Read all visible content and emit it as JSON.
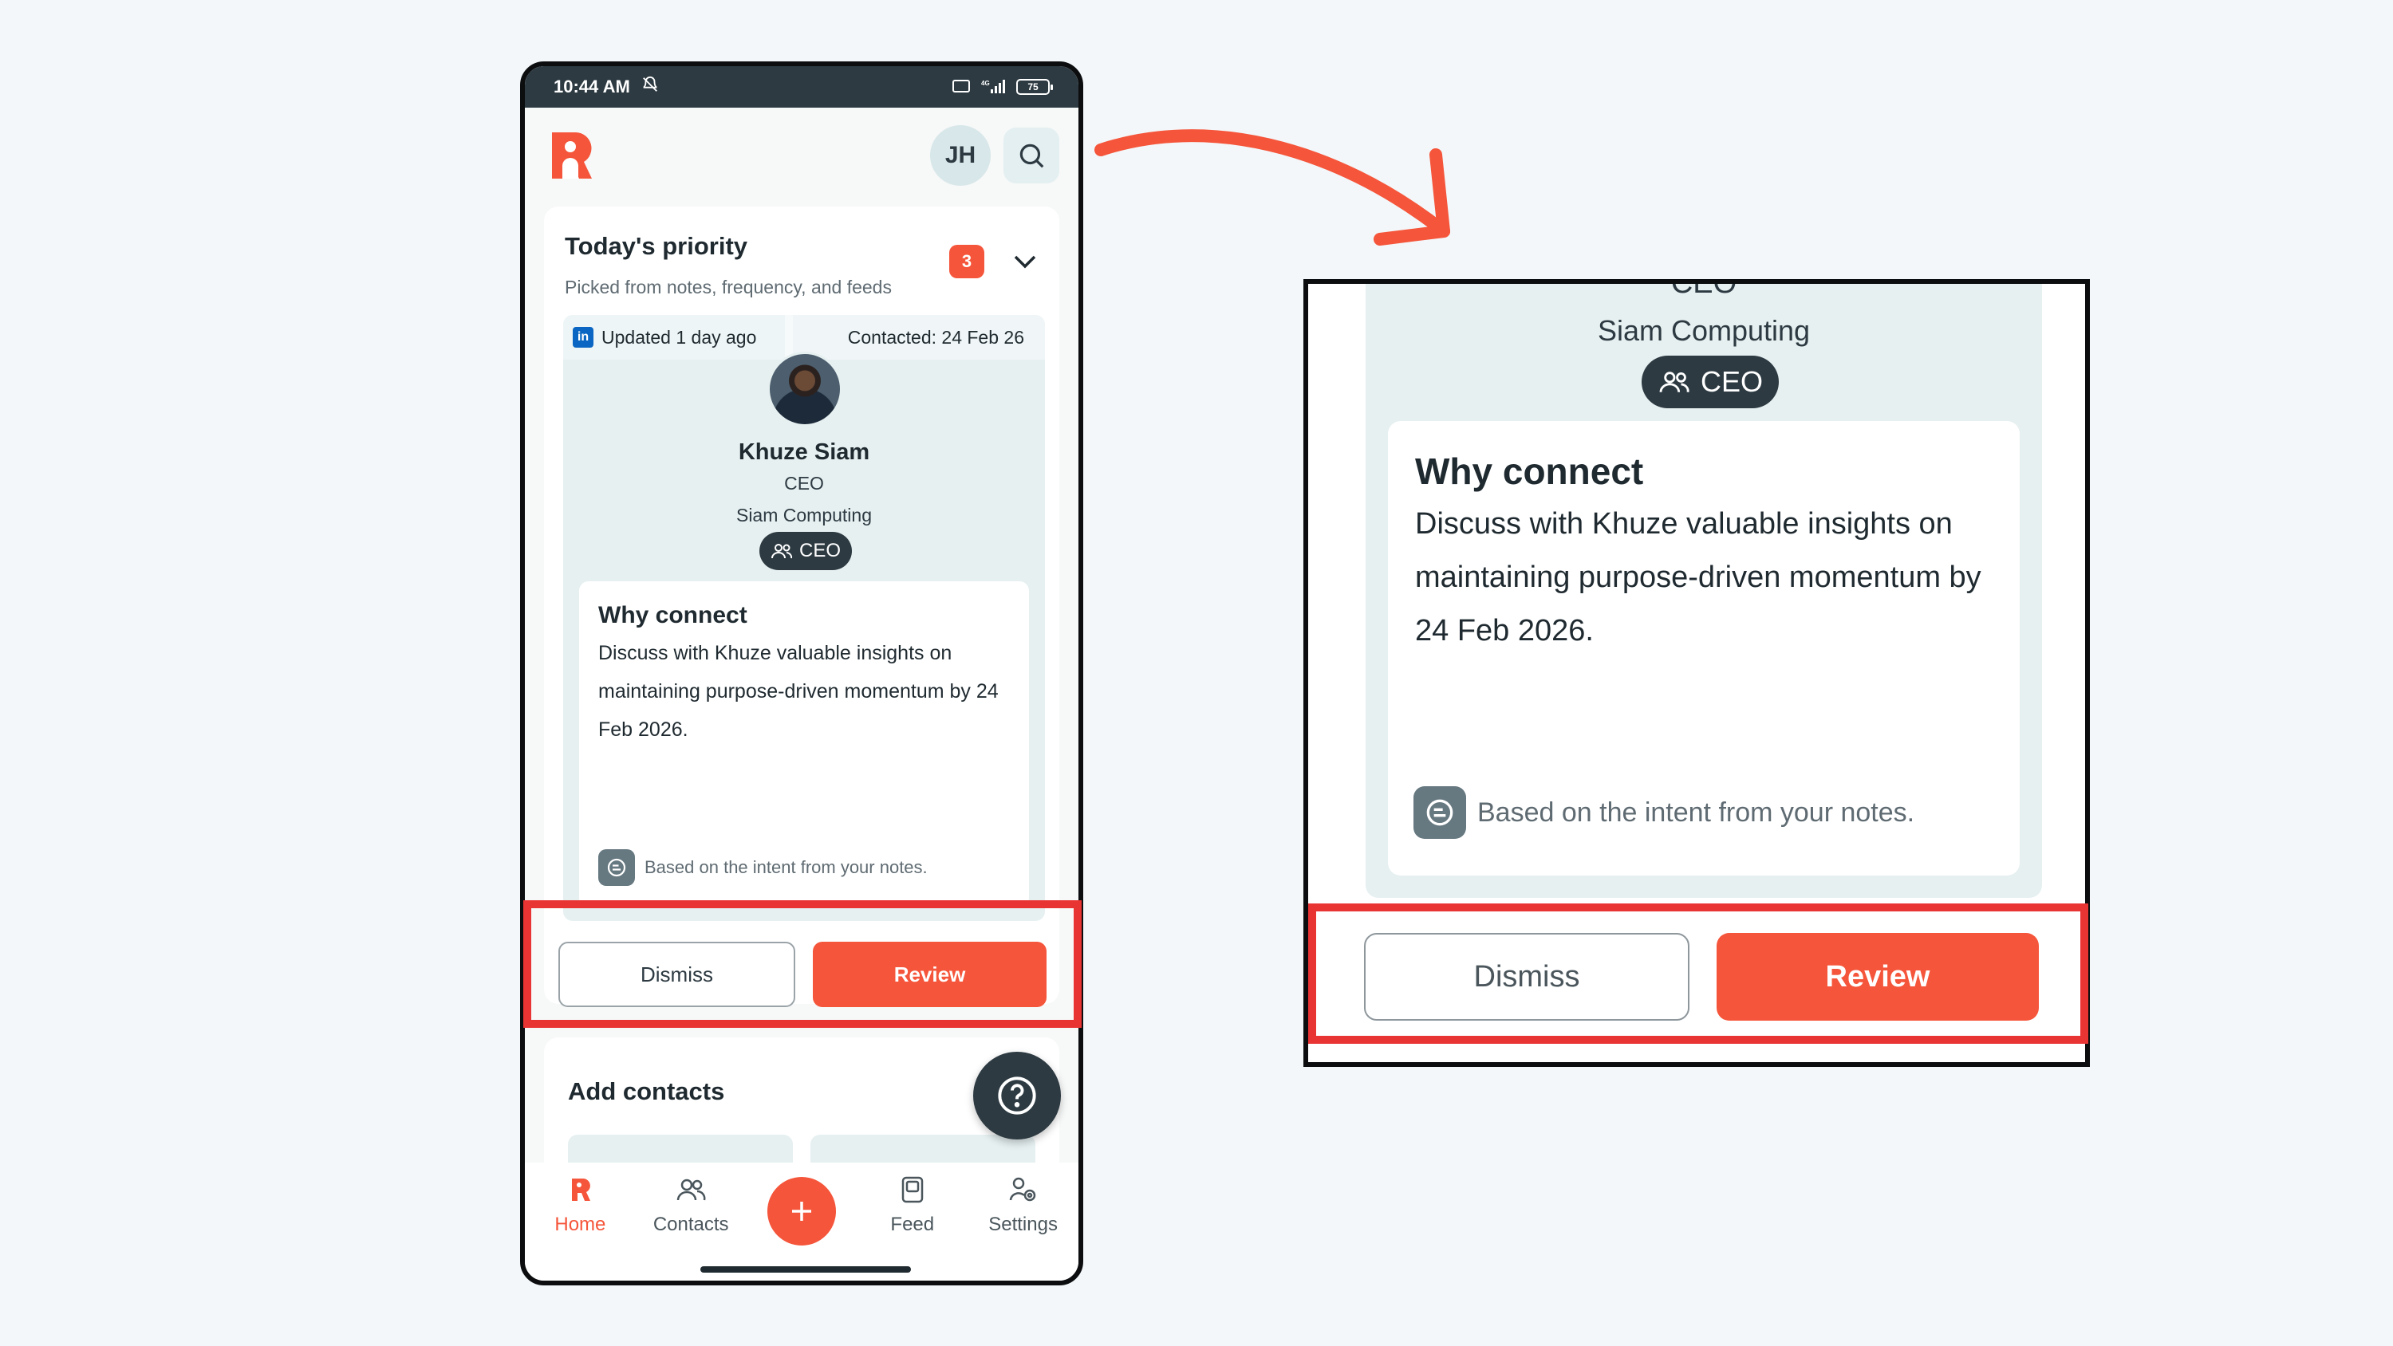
{
  "status_bar": {
    "time": "10:44 AM",
    "battery": "75"
  },
  "header": {
    "initials": "JH"
  },
  "priority": {
    "title": "Today's priority",
    "subtitle": "Picked from notes, frequency, and feeds",
    "count": "3"
  },
  "contact": {
    "updated": "Updated 1 day ago",
    "contacted": "Contacted: 24 Feb 26",
    "name": "Khuze Siam",
    "role": "CEO",
    "company": "Siam Computing",
    "chip": "CEO"
  },
  "why_connect": {
    "title": "Why connect",
    "body": "Discuss with Khuze valuable insights on maintaining purpose-driven momentum by 24 Feb 2026.",
    "footer": "Based on the intent from your notes."
  },
  "actions": {
    "dismiss": "Dismiss",
    "review": "Review"
  },
  "add_contacts": {
    "title": "Add contacts"
  },
  "nav": {
    "home": "Home",
    "contacts": "Contacts",
    "feed": "Feed",
    "settings": "Settings"
  },
  "zoom": {
    "role_cut": "CEO",
    "company": "Siam Computing",
    "chip": "CEO"
  },
  "colors": {
    "accent": "#f5553a",
    "dark": "#2d3a42",
    "card_bg": "#e6f0f1",
    "highlight": "#e93434"
  },
  "icons": [
    "linkedin-icon",
    "search-icon",
    "chevron-down-icon",
    "group-icon",
    "intent-icon",
    "help-icon",
    "home-icon",
    "contacts-icon",
    "plus-icon",
    "feed-icon",
    "settings-icon"
  ]
}
